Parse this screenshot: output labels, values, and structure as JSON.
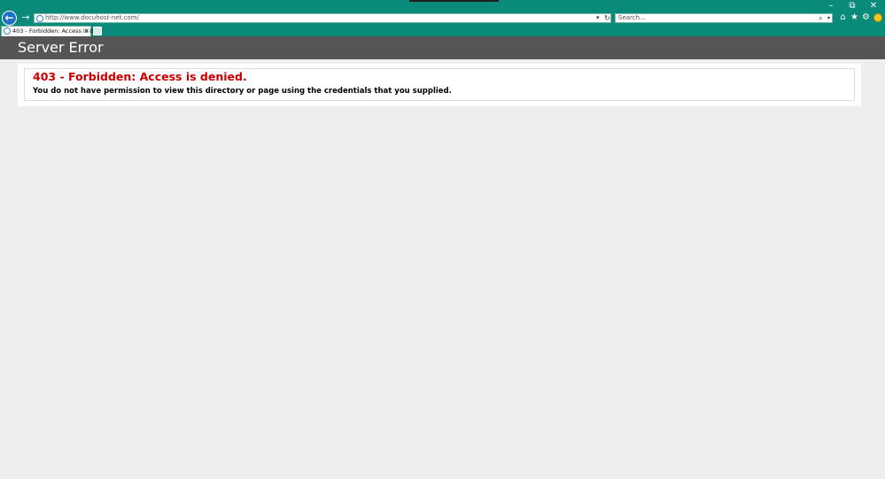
{
  "browser": {
    "address_url": "http://www.docuhost-net.com/",
    "search_placeholder": "Search...",
    "tab_title": "403 - Forbidden: Access is d...",
    "window_buttons": {
      "minimize": "–",
      "restore": "⧉",
      "close": "✕"
    },
    "icons": {
      "back": "←",
      "forward": "→",
      "home": "⌂",
      "favorites": "★",
      "settings": "⚙",
      "search": "⌕",
      "refresh": "↻",
      "dropdown": "▾",
      "tab_close": "✕"
    },
    "colors": {
      "chrome": "#0a8a78",
      "back_button": "#1c6fc4"
    }
  },
  "page": {
    "header_title": "Server Error",
    "error_heading": "403 - Forbidden: Access is denied.",
    "error_message": "You do not have permission to view this directory or page using the credentials that you supplied.",
    "colors": {
      "header_bg": "#555555",
      "error_heading": "#cc0000",
      "page_bg": "#eeeeee"
    }
  }
}
